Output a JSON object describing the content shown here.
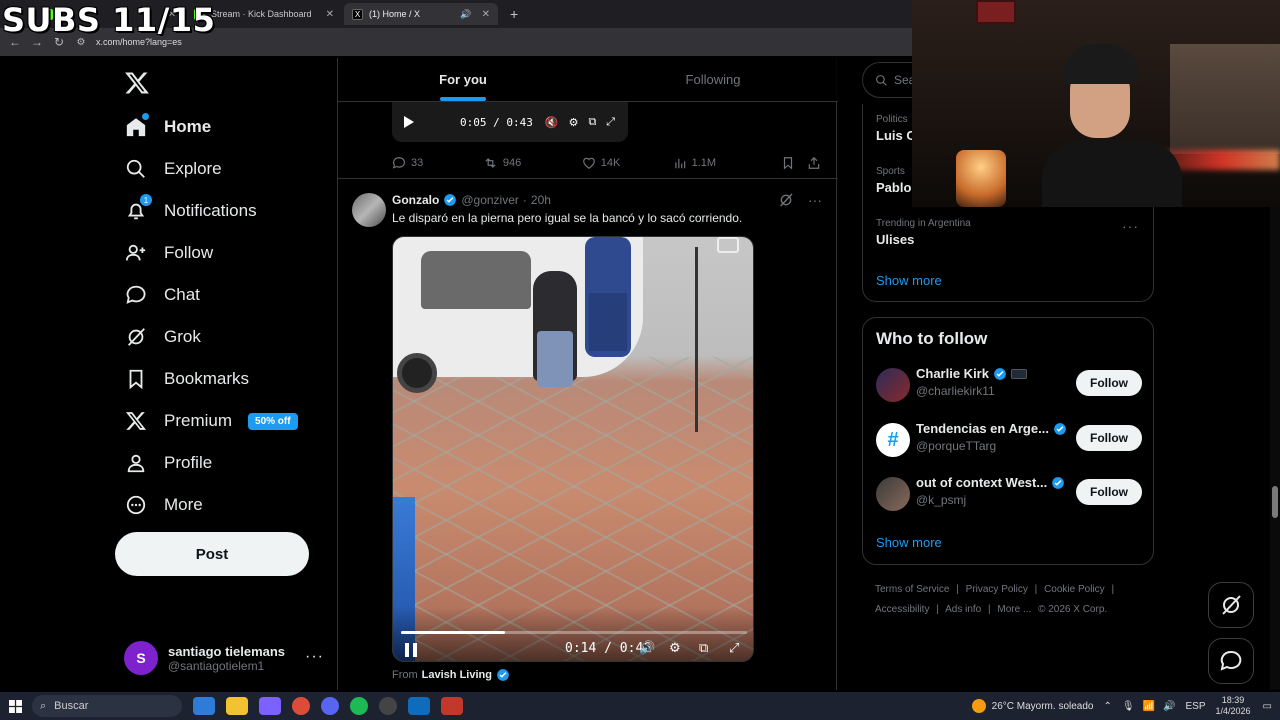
{
  "overlay": {
    "subs_text": "SUBS 11/15"
  },
  "browser": {
    "tabs": [
      {
        "label": "Stream · Kick Dashboard",
        "active": false
      },
      {
        "label": "(1) Home / X",
        "active": true
      }
    ],
    "new_tab": "+",
    "url": "x.com/home?lang=es"
  },
  "nav": {
    "items": [
      {
        "label": "Home",
        "icon": "home-icon"
      },
      {
        "label": "Explore",
        "icon": "search-icon"
      },
      {
        "label": "Notifications",
        "icon": "bell-icon",
        "badge": "1"
      },
      {
        "label": "Follow",
        "icon": "follow-person-icon"
      },
      {
        "label": "Chat",
        "icon": "chat-bubble-icon"
      },
      {
        "label": "Grok",
        "icon": "grok-icon"
      },
      {
        "label": "Bookmarks",
        "icon": "bookmark-icon"
      },
      {
        "label": "Premium",
        "icon": "x-logo-icon",
        "badge": "50% off"
      },
      {
        "label": "Profile",
        "icon": "person-icon"
      },
      {
        "label": "More",
        "icon": "more-circle-icon"
      }
    ],
    "post_label": "Post",
    "account": {
      "initial": "S",
      "name": "santiago tielemans",
      "handle": "@santiagotielem1",
      "more": "···"
    }
  },
  "feed": {
    "tabs": [
      {
        "label": "For you",
        "active": true
      },
      {
        "label": "Following",
        "active": false
      }
    ],
    "prev_tweet": {
      "video_time": "0:05 / 0:43",
      "replies": "33",
      "reposts": "946",
      "likes": "14K",
      "views": "1.1M"
    },
    "tweet": {
      "name": "Gonzalo",
      "handle": "@gonziver",
      "time": "20h",
      "text": "Le disparó en la pierna pero igual se la bancó y lo sacó corriendo.",
      "video_time": "0:14 / 0:46",
      "progress": 0.3,
      "from_label": "From",
      "from_account": "Lavish Living"
    }
  },
  "sidebar": {
    "search_placeholder": "Sea",
    "trends": [
      {
        "category": "Politics",
        "title": "Luis C"
      },
      {
        "category": "Sports",
        "title": "Pablo"
      },
      {
        "category": "Trending in Argentina",
        "title": "Ulises"
      }
    ],
    "trends_show_more": "Show more",
    "who_to_follow_title": "Who to follow",
    "follow_suggestions": [
      {
        "name": "Charlie Kirk",
        "handle": "@charliekirk11",
        "button": "Follow"
      },
      {
        "name": "Tendencias en Arge...",
        "handle": "@porqueTTarg",
        "button": "Follow"
      },
      {
        "name": "out of context West...",
        "handle": "@k_psmj",
        "button": "Follow"
      }
    ],
    "wtf_show_more": "Show more",
    "footer": [
      "Terms of Service",
      "|",
      "Privacy Policy",
      "|",
      "Cookie Policy",
      "|",
      "Accessibility",
      "|",
      "Ads info",
      "|",
      "More ...",
      "© 2026 X Corp."
    ]
  },
  "taskbar": {
    "search": "Buscar",
    "weather": "26°C  Mayorm. soleado",
    "lang": "ESP",
    "time": "18:39",
    "date": "1/4/2026"
  },
  "colors": {
    "accent": "#1d9bf0",
    "background": "#000000",
    "border": "#2f3336",
    "muted": "#71767b"
  }
}
